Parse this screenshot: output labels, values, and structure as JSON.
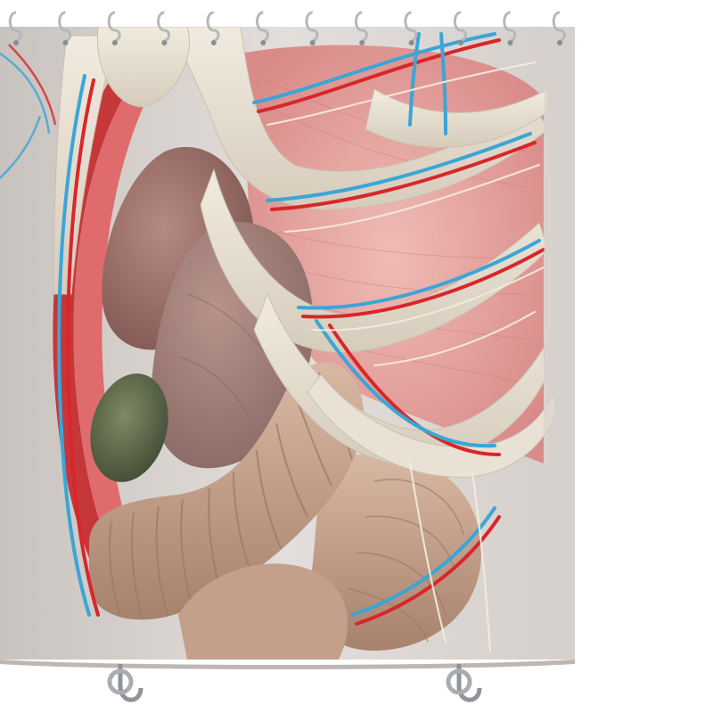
{
  "product": {
    "type": "shower-curtain",
    "print": "anatomy-torso-illustration",
    "hook_count": 12,
    "colors": {
      "background": "#ffffff",
      "curtain_base": "#d9d4d0",
      "bone": "#e8e0d2",
      "muscle": "#e6a3a0",
      "artery": "#d8262b",
      "vein": "#3aa6d6",
      "nerve": "#f1ead9",
      "intestine": "#c9a48e",
      "liver": "#9b6c64",
      "gallbladder": "#5f6b4b",
      "hook_metal": "#b5b8bc"
    }
  }
}
